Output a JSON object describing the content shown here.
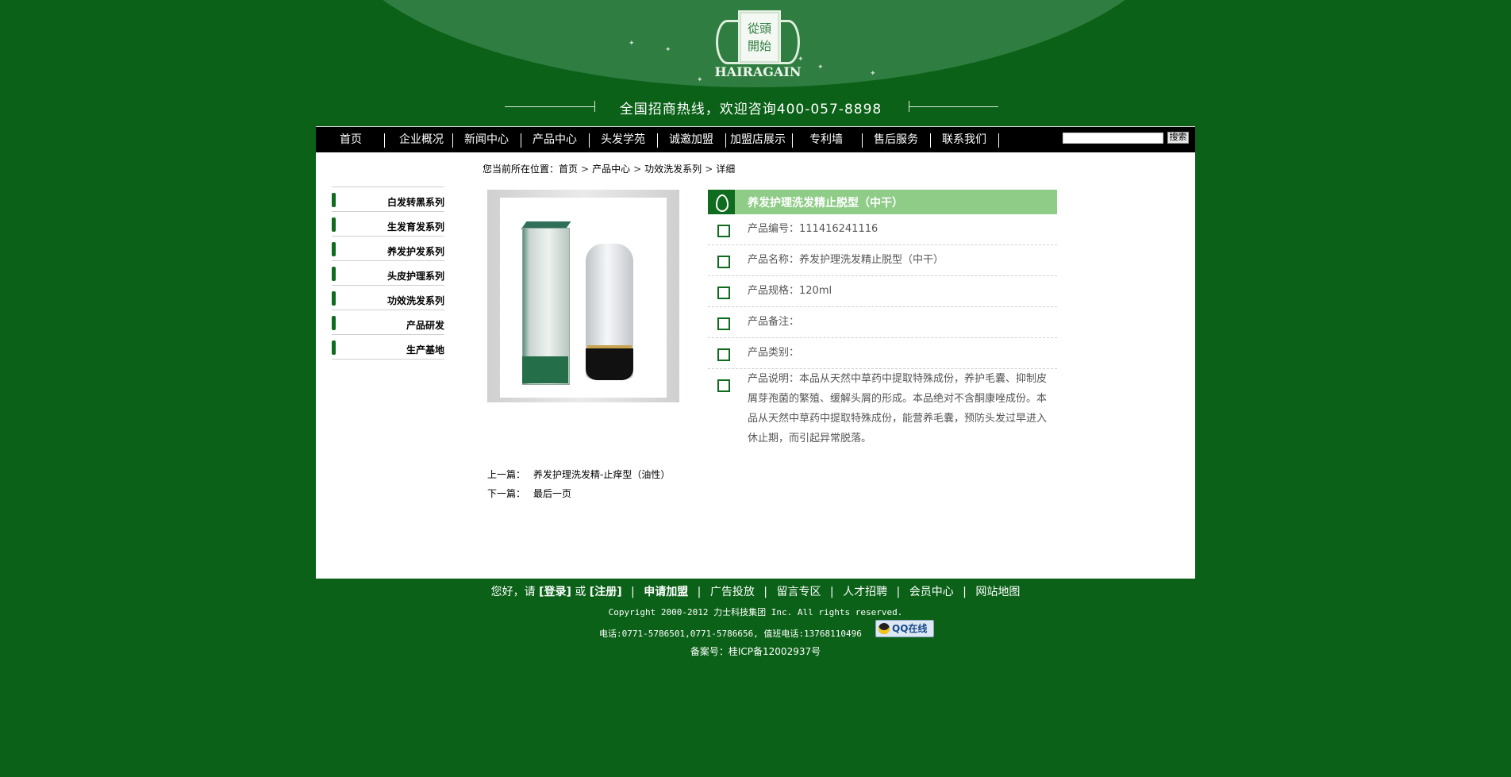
{
  "header": {
    "logo_cn": [
      "從頭",
      "開始"
    ],
    "logo_en": "HAIRAGAIN",
    "hotline": "全国招商热线，欢迎咨询400-057-8898"
  },
  "nav": {
    "items": [
      "首页",
      "企业概况",
      "新闻中心",
      "产品中心",
      "头发学苑",
      "诚邀加盟",
      "加盟店展示",
      "专利墙",
      "售后服务",
      "联系我们"
    ],
    "search_button": "搜索",
    "search_value": ""
  },
  "sidebar": {
    "items": [
      "白发转黑系列",
      "生发育发系列",
      "养发护发系列",
      "头皮护理系列",
      "功效洗发系列",
      "产品研发",
      "生产基地"
    ]
  },
  "breadcrumb": {
    "prefix": "您当前所在位置：",
    "items": [
      "首页",
      "产品中心",
      "功效洗发系列",
      "详细"
    ],
    "separator": ">"
  },
  "product": {
    "title": "养发护理洗发精止脱型（中干）",
    "fields": [
      "产品编号：111416241116",
      "产品名称：养发护理洗发精止脱型（中干）",
      "产品规格：120ml",
      "产品备注：",
      "产品类别：",
      "产品说明：本品从天然中草药中提取特殊成份，养护毛囊、抑制皮屑芽孢菌的繁殖、缓解头屑的形成。本品绝对不含酮康唑成份。本品从天然中草药中提取特殊成份，能营养毛囊，预防头发过早进入休止期，而引起异常脱落。"
    ]
  },
  "pager": {
    "prev_label": "上一篇：",
    "prev_value": "养发护理洗发精-止痒型（油性）",
    "next_label": "下一篇：",
    "next_value": "最后一页"
  },
  "footer": {
    "greeting": "您好，请",
    "login": "[登录]",
    "or": "或",
    "register": "[注册]",
    "links": [
      "申请加盟",
      "广告投放",
      "留言专区",
      "人才招聘",
      "会员中心",
      "网站地图"
    ],
    "copyright": "Copyright  2000-2012  力士科技集团  Inc. All rights reserved.",
    "phone": "电话:0771-5786501,0771-5786656,    值班电话:13768110496",
    "qq": "QQ在线",
    "beian": "备案号：桂ICP备12002937号"
  },
  "colors": {
    "background": "#0b6118",
    "accent": "#0f6b1e",
    "title_bar": "#8fcc88"
  }
}
